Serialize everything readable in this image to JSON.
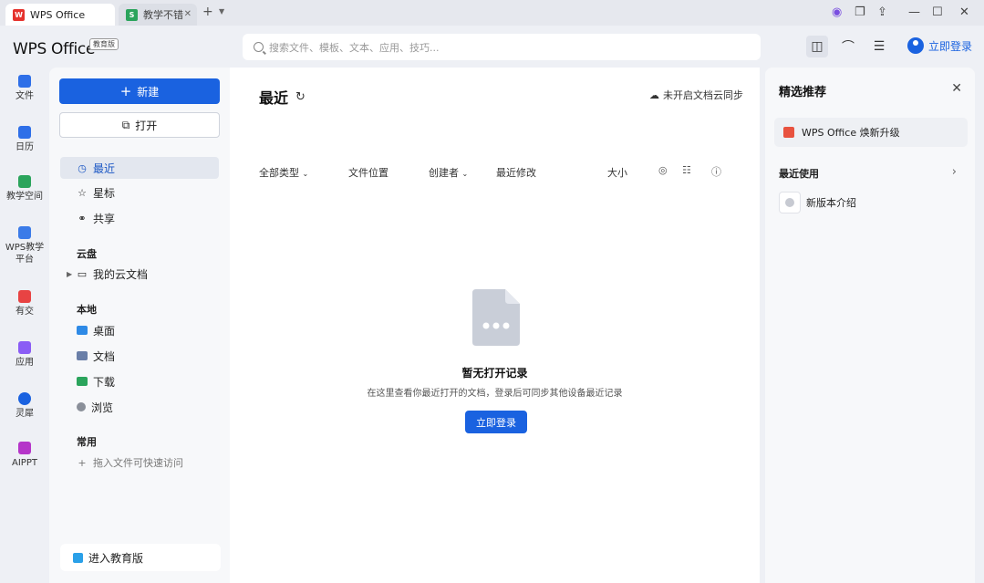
{
  "tabs": [
    {
      "label": "WPS Office"
    },
    {
      "label": "教学不错"
    }
  ],
  "header": {
    "logo": "WPS Office",
    "edition_badge": "教育版",
    "search_placeholder": "搜索文件、模板、文本、应用、技巧...",
    "login": "立即登录"
  },
  "rail": [
    {
      "label": "文件",
      "color": "#2e6fe8"
    },
    {
      "label": "日历",
      "color": "#2e6fe8"
    },
    {
      "label": "教学空间",
      "color": "#2ba45c"
    },
    {
      "label": "WPS教学平台",
      "color": "#3b7be8"
    },
    {
      "label": "有交",
      "color": "#e84343"
    },
    {
      "label": "应用",
      "color": "#8a5cf5"
    },
    {
      "label": "灵犀",
      "color": "#1a62e0"
    },
    {
      "label": "AIPPT",
      "color": "#b535c9"
    }
  ],
  "left": {
    "new_label": "新建",
    "open_label": "打开",
    "nav_recent": "最近",
    "nav_star": "星标",
    "nav_share": "共享",
    "section_cloud": "云盘",
    "cloud_docs": "我的云文档",
    "section_local": "本地",
    "local_desktop": "桌面",
    "local_docs": "文档",
    "local_download": "下载",
    "local_browse": "浏览",
    "section_common": "常用",
    "common_hint": "拖入文件可快速访问",
    "edu_button": "进入教育版"
  },
  "main": {
    "title": "最近",
    "sync_label": "未开启文档云同步",
    "columns": {
      "type": "全部类型",
      "location": "文件位置",
      "creator": "创建者",
      "modified": "最近修改",
      "size": "大小"
    },
    "empty_title": "暂无打开记录",
    "empty_desc": "在这里查看你最近打开的文档，登录后可同步其他设备最近记录",
    "empty_button": "立即登录"
  },
  "right": {
    "title": "精选推荐",
    "card_label": "WPS Office 焕新升级",
    "section_recent": "最近使用",
    "item_label": "新版本介绍"
  },
  "colors": {
    "accent": "#1a62e0"
  }
}
